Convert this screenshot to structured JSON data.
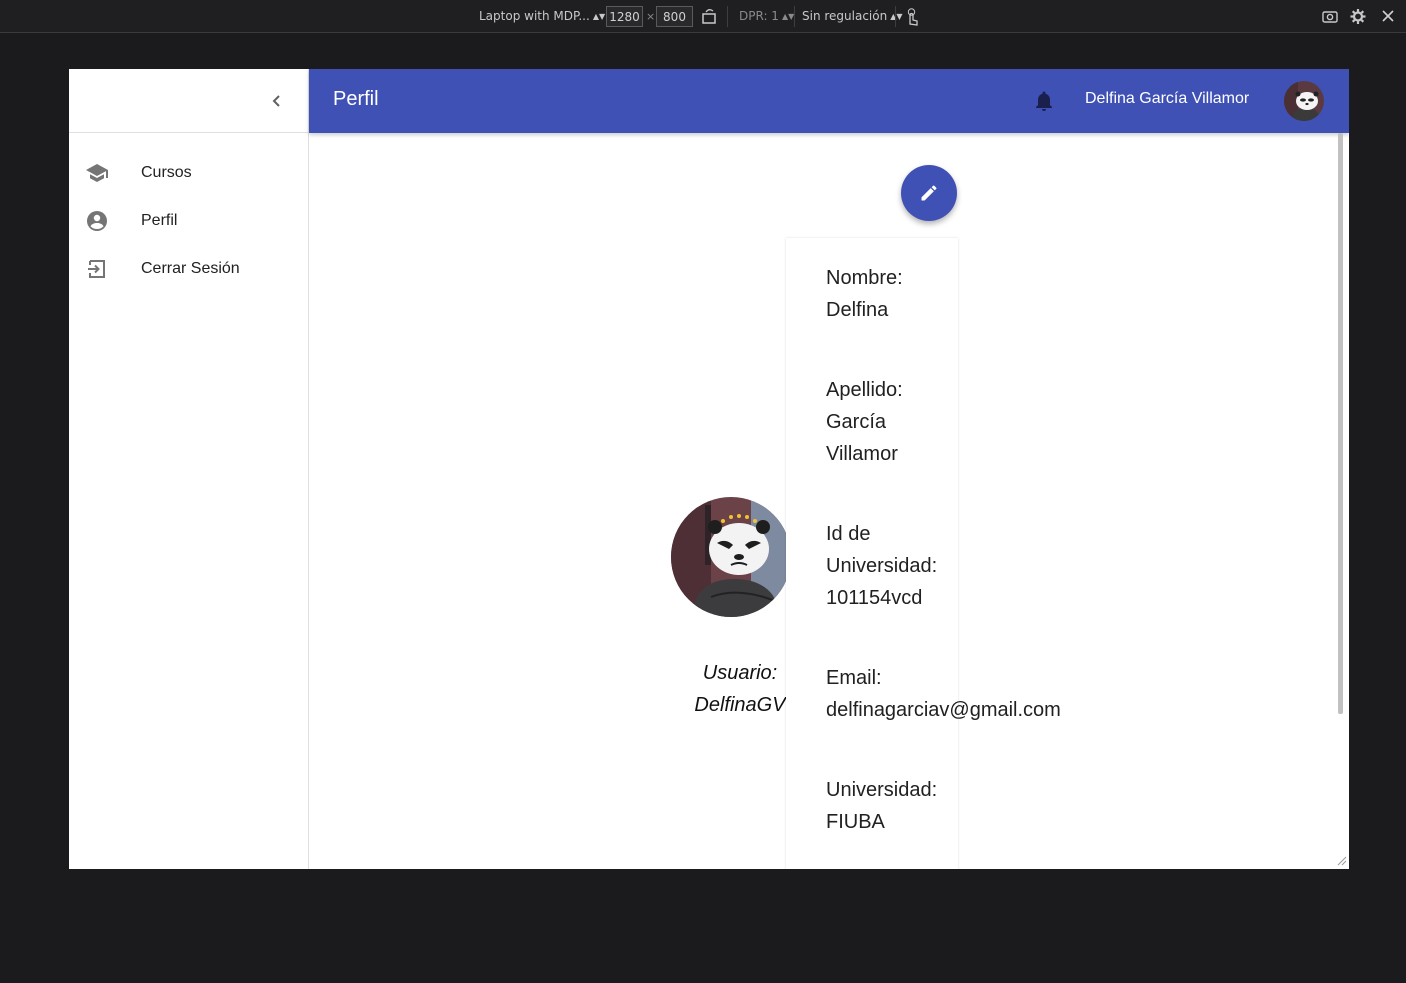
{
  "devtools": {
    "device": "Laptop with MDP...",
    "width": "1280",
    "times": "×",
    "height": "800",
    "dpr": "DPR: 1",
    "throttling": "Sin regulación"
  },
  "drawer": {
    "items": [
      {
        "label": "Cursos",
        "icon": "school-icon"
      },
      {
        "label": "Perfil",
        "icon": "account-circle-icon"
      },
      {
        "label": "Cerrar Sesión",
        "icon": "logout-icon"
      }
    ]
  },
  "appbar": {
    "title": "Perfil",
    "user_name": "Delfina García Villamor"
  },
  "profile": {
    "username_label": "Usuario:",
    "username": "DelfinaGV",
    "fields": [
      {
        "label": "Nombre:",
        "value": "Delfina"
      },
      {
        "label": "Apellido:",
        "value": "García Villamor"
      },
      {
        "label": "Id de Universidad:",
        "value": "101154vcd"
      },
      {
        "label": "Email:",
        "value": "delfinagarciav@gmail.com"
      },
      {
        "label": "Universidad:",
        "value": "FIUBA"
      }
    ]
  },
  "colors": {
    "primary": "#3f51b5",
    "background": "#ffffff",
    "devtools_bg": "#1b1b1d"
  }
}
